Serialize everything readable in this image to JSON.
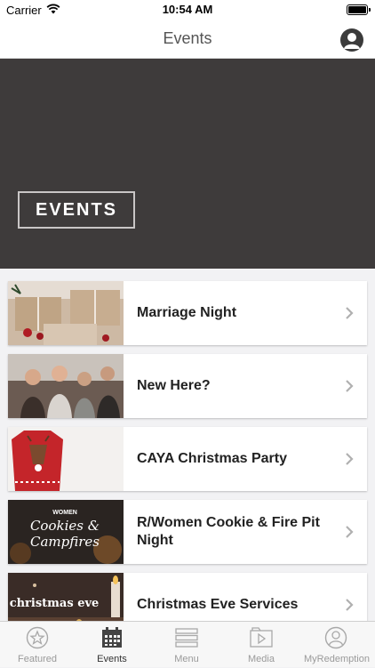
{
  "status": {
    "carrier": "Carrier",
    "time": "10:54 AM"
  },
  "nav": {
    "title": "Events",
    "profile_icon": "person-icon"
  },
  "hero": {
    "badge": "EVENTS",
    "background": "#3e3b3b"
  },
  "events": [
    {
      "title": "Marriage Night",
      "image": "gift-boxes-image"
    },
    {
      "title": "New Here?",
      "image": "people-gathering-image"
    },
    {
      "title": "CAYA Christmas Party",
      "image": "christmas-sweater-image"
    },
    {
      "title": "R/Women Cookie & Fire Pit Night",
      "image": "cookies-campfires-image",
      "thumb_text_1": "WOMEN",
      "thumb_text_2": "Cookies &",
      "thumb_text_3": "Campfires"
    },
    {
      "title": "Christmas Eve Services",
      "image": "christmas-eve-candles-image",
      "thumb_text_1": "christmas eve"
    }
  ],
  "tabs": [
    {
      "label": "Featured",
      "icon": "star-icon",
      "active": false
    },
    {
      "label": "Events",
      "icon": "calendar-icon",
      "active": true
    },
    {
      "label": "Menu",
      "icon": "menu-icon",
      "active": false
    },
    {
      "label": "Media",
      "icon": "media-play-icon",
      "active": false
    },
    {
      "label": "MyRedemption",
      "icon": "user-circle-icon",
      "active": false
    }
  ]
}
